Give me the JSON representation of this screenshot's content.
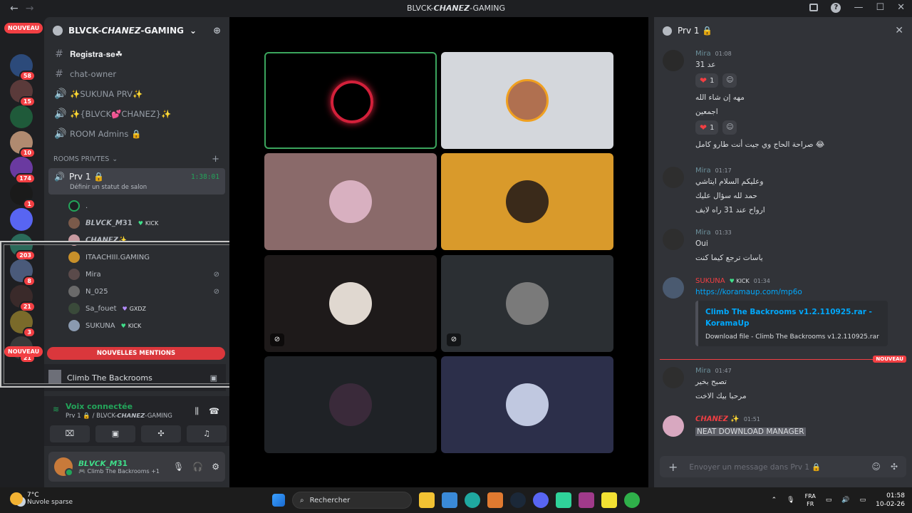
{
  "window": {
    "title": "BLVCK-𝘾𝙃𝘼𝙉𝙀𝙕-GAMING",
    "back": "←",
    "forward": "→"
  },
  "rail": {
    "nouveau_top": "NOUVEAU",
    "nouveau_bottom": "NOUVEAU",
    "servers": [
      {
        "badge": "58",
        "color": "#2c4a7a"
      },
      {
        "badge": "15",
        "color": "#5a3a3a"
      },
      {
        "badge": "",
        "color": "#1f5a3a"
      },
      {
        "badge": "10",
        "color": "#b08a70"
      },
      {
        "badge": "174",
        "color": "#6a3aa0"
      },
      {
        "badge": "1",
        "color": "#1a1a1a"
      },
      {
        "badge": "",
        "color": "#5865f2"
      },
      {
        "badge": "203",
        "color": "#2a6a5a"
      },
      {
        "badge": "8",
        "color": "#4a5a7a"
      },
      {
        "badge": "21",
        "color": "#3a2a2a"
      },
      {
        "badge": "3",
        "color": "#7a6a2a"
      },
      {
        "badge": "21",
        "color": "#3a3a3a"
      }
    ]
  },
  "guild": {
    "name": "BLVCK-𝘾𝙃𝘼𝙉𝙀𝙕-GAMING",
    "channels": [
      {
        "icon": "#",
        "name": "𝐑𝐞𝐠𝐢𝐬𝐭𝐫𝐚-𝐬𝐞☘",
        "type": "text"
      },
      {
        "icon": "#",
        "name": "chat-owner",
        "type": "text"
      },
      {
        "icon": "🔊",
        "name": "✨SUKUNA PRV✨",
        "type": "voice"
      },
      {
        "icon": "🔊",
        "name": "✨{BLVCK💕CHANEZ}✨",
        "type": "voice"
      },
      {
        "icon": "🔊",
        "name": "ROOM Admins 🔒",
        "type": "voice"
      }
    ],
    "category": "ROOMS PRIVTES",
    "voice_channel": {
      "name": "Prv 1 🔒",
      "timer": "1:38:01",
      "status_hint": "Définir un statut de salon"
    },
    "voice_users": [
      {
        "name": ".",
        "tag": "",
        "muted": false,
        "color": "#1e1f22"
      },
      {
        "name": "𝘽𝙇𝙑𝘾𝙆_𝙈𝟯𝟭",
        "tag": "KICK",
        "muted": false,
        "color": "#7a5a4a"
      },
      {
        "name": "𝘾𝙃𝘼𝙉𝙀𝙕✨",
        "tag": "",
        "muted": false,
        "color": "#c89aa0"
      },
      {
        "name": "ITAACHIII.GAMING",
        "tag": "",
        "muted": false,
        "color": "#c8902a"
      },
      {
        "name": "Mira",
        "tag": "",
        "muted": true,
        "color": "#5a4a4a"
      },
      {
        "name": "N_025",
        "tag": "",
        "muted": true,
        "color": "#6a6a6a"
      },
      {
        "name": "Sa_fouet",
        "tag": "GXDZ",
        "muted": false,
        "color": "#3a4a3a"
      },
      {
        "name": "SUKUNA",
        "tag": "KICK",
        "muted": false,
        "color": "#8a9ab0"
      }
    ],
    "mentions_button": "NOUVELLES MENTIONS",
    "activity": "Climb The Backrooms",
    "voice_connected": "Voix connectée",
    "voice_location": "Prv 1 🔒 / BLVCK-𝘾𝙃𝘼𝙉𝙀𝙕-GAMING"
  },
  "user": {
    "name": "𝘽𝙇𝙑𝘾𝙆_𝙈𝟯𝟭",
    "status": "🎮 Climb The Backrooms +1"
  },
  "stage": {
    "tiles": [
      {
        "bg": "#000000",
        "av": "#4a0a10",
        "border": "#3ba55d",
        "mic_off": false
      },
      {
        "bg": "#d4d7dc",
        "av": "#b07050",
        "border": "",
        "mic_off": false
      },
      {
        "bg": "#8a6a6a",
        "av": "#d8b0c0",
        "border": "",
        "mic_off": false
      },
      {
        "bg": "#d99a2b",
        "av": "#3a2a1a",
        "border": "",
        "mic_off": false
      },
      {
        "bg": "#1e1a1a",
        "av": "#e0d8d0",
        "border": "",
        "mic_off": true
      },
      {
        "bg": "#2b2f33",
        "av": "#7a7a7a",
        "border": "",
        "mic_off": true
      },
      {
        "bg": "#1f2226",
        "av": "#3a2a3a",
        "border": "",
        "mic_off": false
      },
      {
        "bg": "#2c2f4a",
        "av": "#c0c8e0",
        "border": "",
        "mic_off": false
      }
    ]
  },
  "chat": {
    "title": "Prv 1 🔒",
    "messages": [
      {
        "author": "Mira",
        "color": "#6b8f9a",
        "time": "01:08",
        "lines": [
          "عد 31"
        ],
        "reactions": "1"
      },
      {
        "author": "",
        "color": "",
        "time": "",
        "lines": [
          "مهه إن شاء الله",
          "اجمعين"
        ],
        "reactions": "1"
      },
      {
        "author": "",
        "color": "",
        "time": "",
        "lines": [
          "😂 صراحة الحاج وي جيت أنت طارو كامل"
        ]
      },
      {
        "author": "Mira",
        "color": "#6b8f9a",
        "time": "01:17",
        "lines": [
          "وعليكم السلام ايتاشي",
          "حمد لله سؤال عليك",
          "ارواح عند 31 راه لايف"
        ]
      },
      {
        "author": "Mira",
        "color": "#6b8f9a",
        "time": "01:33",
        "lines": [
          "Oui",
          "ياسات ترجع كيما كنت"
        ]
      },
      {
        "author": "SUKUNA",
        "tag": "KICK",
        "color": "#f23f43",
        "time": "01:34",
        "lines": [
          "https://koramaup.com/mp6o"
        ]
      },
      {
        "author": "Mira",
        "color": "#6b8f9a",
        "time": "01:47",
        "lines": [
          "تصبح بخير",
          "مرحبا بيك الاخت"
        ]
      },
      {
        "author": "𝘾𝙃𝘼𝙉𝙀𝙕 ✨",
        "color": "#f23f43",
        "time": "01:51",
        "lines": [
          "NEAT DOWNLOAD MANAGER"
        ]
      }
    ],
    "embed": {
      "title": "Climb The Backrooms v1.2.110925.rar - KoramaUp",
      "desc": "Download file - Climb The Backrooms v1.2.110925.rar"
    },
    "new_divider": "NOUVEAU",
    "composer_placeholder": "Envoyer un message dans Prv 1 🔒"
  },
  "taskbar": {
    "temp": "7°C",
    "weather": "Nuvole sparse",
    "search": "Rechercher",
    "lang_top": "FRA",
    "lang_bottom": "FR",
    "time": "01:58",
    "date": "10-02-26"
  }
}
